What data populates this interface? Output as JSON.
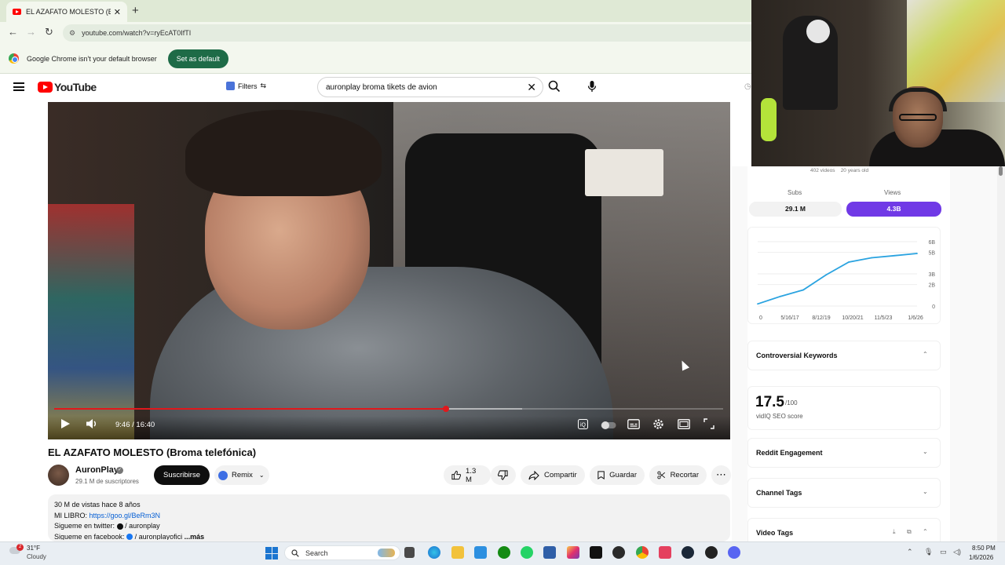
{
  "browser": {
    "tab_title": "EL AZAFATO MOLESTO (Broma",
    "tab_close": "✕",
    "new_tab": "+",
    "url": "youtube.com/watch?v=ryEcAT0IfTI",
    "infobar_text": "Google Chrome isn't your default browser",
    "set_default_label": "Set as default"
  },
  "youtube": {
    "logo_text": "YouTube",
    "filters_label": "Filters",
    "search_query": "auronplay broma tikets de avion"
  },
  "player": {
    "time": "9:46 / 16:40",
    "progress": 0.586,
    "buffered": 0.7
  },
  "video": {
    "title": "EL AZAFATO MOLESTO (Broma telefónica)",
    "channel": "AuronPlay",
    "subscribers": "29.1 M de suscriptores",
    "subscribe_label": "Suscribirse",
    "remix_label": "Remix",
    "likes": "1.3 M",
    "share_label": "Compartir",
    "save_label": "Guardar",
    "clip_label": "Recortar",
    "desc_line1": "30 M de vistas  hace 8 años",
    "desc_line2_prefix": "MI LIBRO: ",
    "desc_line2_link": "https://goo.gl/BeRm3N",
    "desc_line3": "Sigueme en twitter:",
    "desc_line3_handle": "/ auronplay",
    "desc_line4": "Sigueme en facebook:",
    "desc_line4_handle": "/ auronplayofici",
    "desc_more": "...más"
  },
  "vidiq": {
    "meta_videos": "402 videos",
    "meta_age": "20 years old",
    "subs_label": "Subs",
    "views_label": "Views",
    "subs_value": "29.1 M",
    "views_value": "4.3B",
    "controversial_label": "Controversial Keywords",
    "seo_score": "17.5",
    "seo_max": "/100",
    "seo_label": "vidIQ SEO score",
    "reddit_label": "Reddit Engagement",
    "channel_tags_label": "Channel Tags",
    "video_tags_label": "Video Tags",
    "accent_color": "#7039e6"
  },
  "chart_data": {
    "type": "line",
    "x": [
      "0",
      "5/16/17",
      "8/12/19",
      "10/20/21",
      "11/5/23",
      "1/6/26"
    ],
    "yticks": [
      "0",
      "2B",
      "3B",
      "5B",
      "6B"
    ],
    "series": [
      {
        "values": [
          0.2,
          0.9,
          1.5,
          2.9,
          4.1,
          4.5,
          4.7,
          4.9
        ]
      }
    ],
    "ylim": [
      0,
      6
    ],
    "color": "#2aa3e0"
  },
  "taskbar": {
    "weather_temp": "31°F",
    "weather_desc": "Cloudy",
    "weather_badge": "2",
    "search_label": "Search",
    "time": "8:50 PM",
    "date": "1/6/2026"
  }
}
